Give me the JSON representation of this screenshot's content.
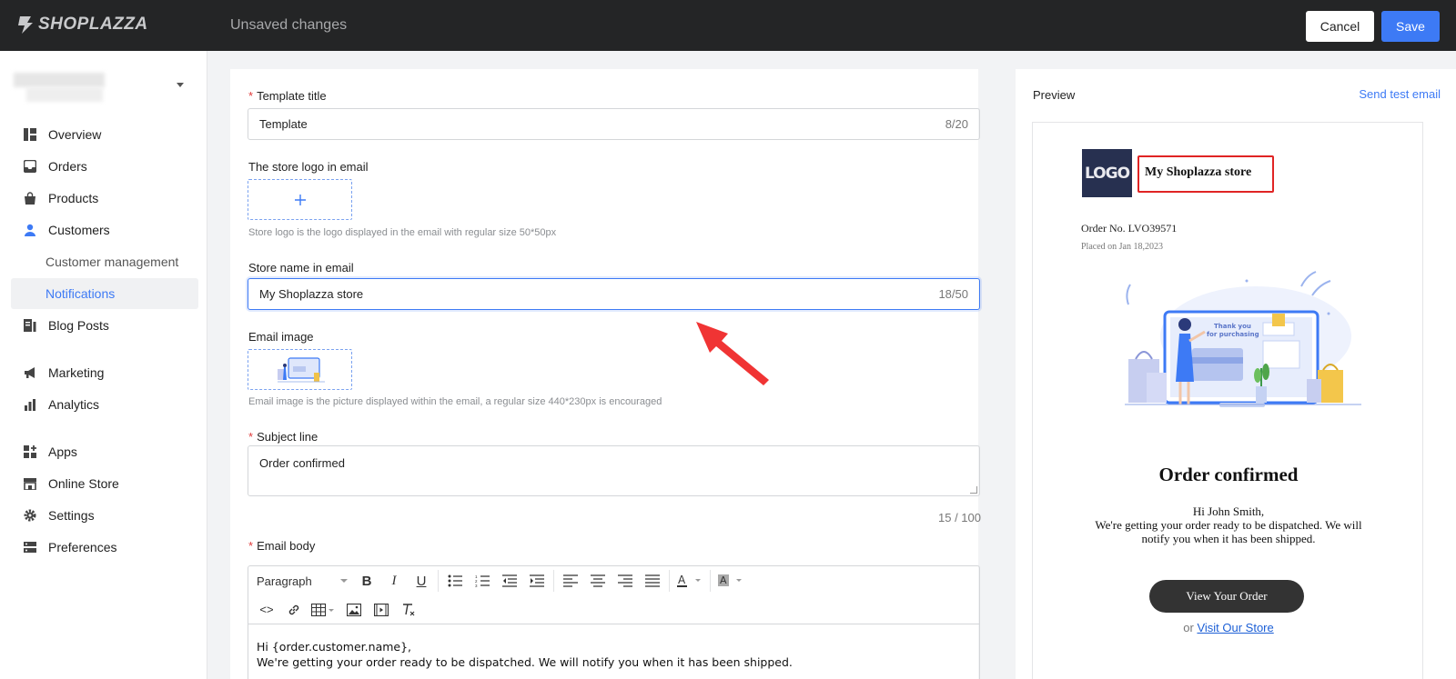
{
  "topbar": {
    "brand": "SHOPLAZZA",
    "status": "Unsaved changes",
    "cancel_label": "Cancel",
    "save_label": "Save"
  },
  "sidebar": {
    "items": [
      {
        "label": "Overview",
        "icon": "overview-icon"
      },
      {
        "label": "Orders",
        "icon": "inbox-icon"
      },
      {
        "label": "Products",
        "icon": "bag-icon"
      },
      {
        "label": "Customers",
        "icon": "person-icon"
      },
      {
        "label": "Customer management"
      },
      {
        "label": "Notifications"
      },
      {
        "label": "Blog Posts",
        "icon": "blog-icon"
      },
      {
        "label": "Marketing",
        "icon": "megaphone-icon"
      },
      {
        "label": "Analytics",
        "icon": "bar-chart-icon"
      },
      {
        "label": "Apps",
        "icon": "apps-icon"
      },
      {
        "label": "Online Store",
        "icon": "store-icon"
      },
      {
        "label": "Settings",
        "icon": "gear-icon"
      },
      {
        "label": "Preferences",
        "icon": "preferences-icon"
      }
    ],
    "active_color": "#3d7af5"
  },
  "form": {
    "template_title": {
      "label": "Template title",
      "value": "Template",
      "count": "8/20"
    },
    "store_logo": {
      "label": "The store logo in email",
      "hint": "Store logo is the logo displayed in the email with regular size 50*50px"
    },
    "store_name": {
      "label": "Store name in email",
      "value": "My Shoplazza store",
      "count": "18/50"
    },
    "email_image": {
      "label": "Email image",
      "hint": "Email image is the picture displayed within the email, a regular size 440*230px is encouraged"
    },
    "subject": {
      "label": "Subject line",
      "value": "Order confirmed",
      "count": "15 / 100"
    },
    "body": {
      "label": "Email body",
      "format_value": "Paragraph",
      "line1": "Hi {order.customer.name},",
      "line2": "We're getting your order ready to be dispatched. We will notify you when it has been shipped."
    }
  },
  "preview": {
    "title": "Preview",
    "send_test": "Send test email",
    "logo_text": "LOGO",
    "store_name": "My Shoplazza store",
    "order_no": "Order No. LVO39571",
    "placed_on": "Placed on Jan 18,2023",
    "illustration_text_1": "Thank you",
    "illustration_text_2": "for purchasing",
    "heading": "Order confirmed",
    "greeting": "Hi John Smith,",
    "message": "We're getting your order ready to be dispatched. We will notify you when it has been shipped.",
    "button": "View Your Order",
    "or": "or",
    "link": "Visit Our Store"
  },
  "colors": {
    "primary": "#3d7af5",
    "topbar": "#242526",
    "highlight": "#e02424",
    "arrow": "#f03434"
  }
}
